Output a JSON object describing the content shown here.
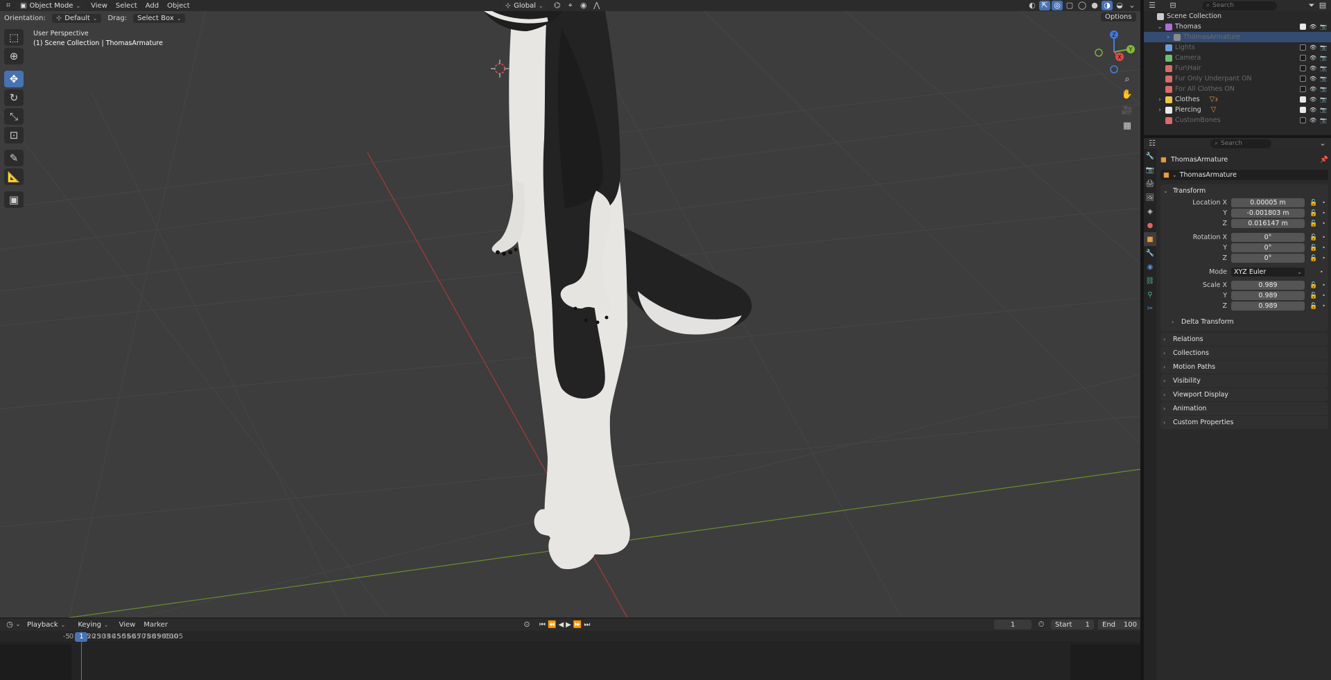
{
  "viewport": {
    "header": {
      "mode": "Object Mode",
      "menus": [
        "View",
        "Select",
        "Add",
        "Object"
      ],
      "transform_space": "Global"
    },
    "subheader": {
      "orientation_label": "Orientation:",
      "orientation_value": "Default",
      "drag_label": "Drag:",
      "drag_value": "Select Box",
      "options": "Options"
    },
    "info": {
      "perspective": "User Perspective",
      "context": "(1) Scene Collection | ThomasArmature"
    },
    "gizmo": {
      "x": "X",
      "y": "Y",
      "z": "Z"
    },
    "colors": {
      "background": "#3d3d3d",
      "x_axis": "#d84a4a",
      "y_axis": "#7fae3c",
      "accent": "#4772b3"
    }
  },
  "timeline": {
    "menus": [
      "Playback",
      "Keying",
      "View",
      "Marker"
    ],
    "current_frame": "1",
    "start_label": "Start",
    "start_value": "1",
    "end_label": "End",
    "end_value": "100",
    "playhead": "1",
    "ticks": [
      "-5",
      "0",
      "5",
      "10",
      "15",
      "20",
      "25",
      "30",
      "35",
      "40",
      "45",
      "50",
      "55",
      "60",
      "65",
      "70",
      "75",
      "80",
      "85",
      "90",
      "95",
      "100",
      "105"
    ]
  },
  "outliner": {
    "search_placeholder": "Search",
    "items": [
      {
        "label": "Scene Collection",
        "depth": 0,
        "icon": "scene-collection-icon",
        "color": "#cccccc",
        "dim": false,
        "checked": null,
        "expander": ""
      },
      {
        "label": "Thomas",
        "depth": 1,
        "icon": "collection-icon",
        "color": "#a870d8",
        "dim": false,
        "checked": true,
        "expander": "⌄"
      },
      {
        "label": "ThomasArmature",
        "depth": 2,
        "icon": "armature-icon",
        "color": "#8a8a8a",
        "dim": true,
        "checked": null,
        "expander": "›",
        "selected": true
      },
      {
        "label": "Lights",
        "depth": 1,
        "icon": "collection-icon",
        "color": "#6c9fd8",
        "dim": true,
        "checked": false,
        "expander": ""
      },
      {
        "label": "Camera",
        "depth": 1,
        "icon": "collection-icon",
        "color": "#6cbf6c",
        "dim": true,
        "checked": false,
        "expander": ""
      },
      {
        "label": "Fur\\Hair",
        "depth": 1,
        "icon": "collection-icon",
        "color": "#d86c6c",
        "dim": true,
        "checked": false,
        "expander": ""
      },
      {
        "label": "Fur Only Underpant ON",
        "depth": 1,
        "icon": "collection-icon",
        "color": "#d86c6c",
        "dim": true,
        "checked": false,
        "expander": ""
      },
      {
        "label": "For All Clothes ON",
        "depth": 1,
        "icon": "collection-icon",
        "color": "#d86c6c",
        "dim": true,
        "checked": false,
        "expander": ""
      },
      {
        "label": "Clothes",
        "depth": 1,
        "icon": "collection-icon",
        "color": "#e8c84a",
        "dim": false,
        "checked": true,
        "expander": "›",
        "badge": "3"
      },
      {
        "label": "Piercing",
        "depth": 1,
        "icon": "collection-icon",
        "color": "#e8e8e8",
        "dim": false,
        "checked": true,
        "expander": "›"
      },
      {
        "label": "CustomBones",
        "depth": 1,
        "icon": "collection-icon",
        "color": "#d86c6c",
        "dim": true,
        "checked": false,
        "expander": ""
      }
    ]
  },
  "properties": {
    "search_placeholder": "Search",
    "object_name_header": "ThomasArmature",
    "object_name_field": "ThomasArmature",
    "transform": {
      "title": "Transform",
      "location_label": "Location X",
      "location": [
        "0.00005 m",
        "-0.001803 m",
        "0.016147 m"
      ],
      "rotation_label": "Rotation X",
      "rotation": [
        "0°",
        "0°",
        "0°"
      ],
      "mode_label": "Mode",
      "mode_value": "XYZ Euler",
      "scale_label": "Scale X",
      "scale": [
        "0.989",
        "0.989",
        "0.989"
      ],
      "y_label": "Y",
      "z_label": "Z",
      "delta": "Delta Transform"
    },
    "panels": [
      "Relations",
      "Collections",
      "Motion Paths",
      "Visibility",
      "Viewport Display",
      "Animation",
      "Custom Properties"
    ]
  }
}
